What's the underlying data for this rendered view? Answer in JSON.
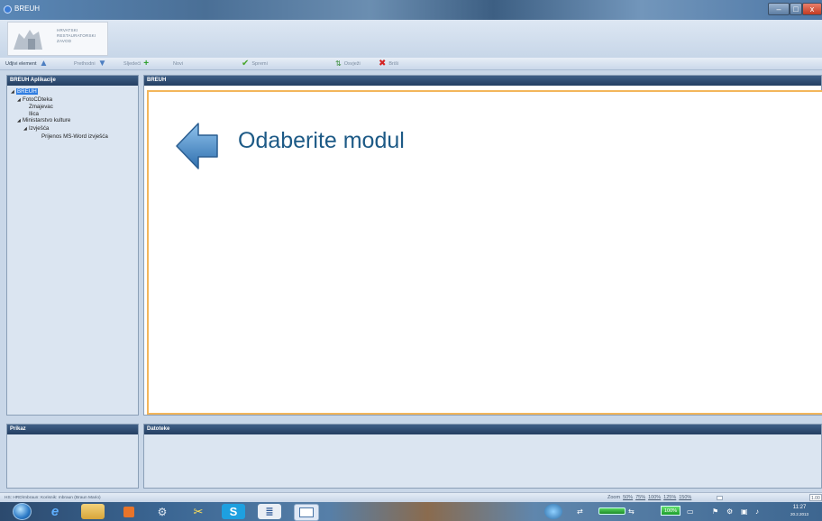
{
  "window": {
    "title": "BREUH",
    "buttons": {
      "minimize": "–",
      "maximize": "□",
      "close": "x"
    }
  },
  "logo": {
    "lines": [
      "HRVATSKI",
      "RESTAURATORSKI",
      "ZAVOD"
    ]
  },
  "toolbar": {
    "items": [
      {
        "label": "Uđjivi element",
        "icon": "arrow-up-icon"
      },
      {
        "label": "Prethodni",
        "icon": "arrow-down-icon"
      },
      {
        "label": "Sljedeći",
        "icon": "add-icon"
      },
      {
        "label": "Novi",
        "icon": "check-icon"
      },
      {
        "label": "Spremi",
        "icon": "refresh-icon"
      },
      {
        "label": "Osvježi",
        "icon": "delete-icon"
      },
      {
        "label": "Briši",
        "icon": ""
      }
    ]
  },
  "left_panel": {
    "title": "BREUH Aplikacije",
    "tree": [
      {
        "label": "BREUH",
        "level": 0,
        "expanded": true,
        "selected": true
      },
      {
        "label": "FotoCDteka",
        "level": 1,
        "expanded": true
      },
      {
        "label": "Zmajevac",
        "level": 2
      },
      {
        "label": "Ilica",
        "level": 2
      },
      {
        "label": "Ministarstvo kulture",
        "level": 1,
        "expanded": true
      },
      {
        "label": "Izvješća",
        "level": 2,
        "expanded": true
      },
      {
        "label": "Prijenos MS-Word izvješća",
        "level": 3
      }
    ]
  },
  "main_panel": {
    "title": "BREUH",
    "prompt": "Odaberite modul"
  },
  "bottom": {
    "left_title": "Prikaz",
    "main_title": "Datoteke"
  },
  "statusbar": {
    "left_text": "HS: HRD\\mbraun: Korisnik: mbraun (Braun Mario)",
    "zoom_label": "Zoom",
    "zoom_levels": [
      "50%",
      "75%",
      "100%",
      "125%",
      "150%"
    ],
    "zoom_value": "1.00"
  },
  "taskbar": {
    "time": "11:27",
    "date": "20.2.2013",
    "battery": "100%"
  },
  "colors": {
    "accent": "#f3b65b",
    "prompt": "#1d5a86",
    "selection": "#2f7de1"
  }
}
